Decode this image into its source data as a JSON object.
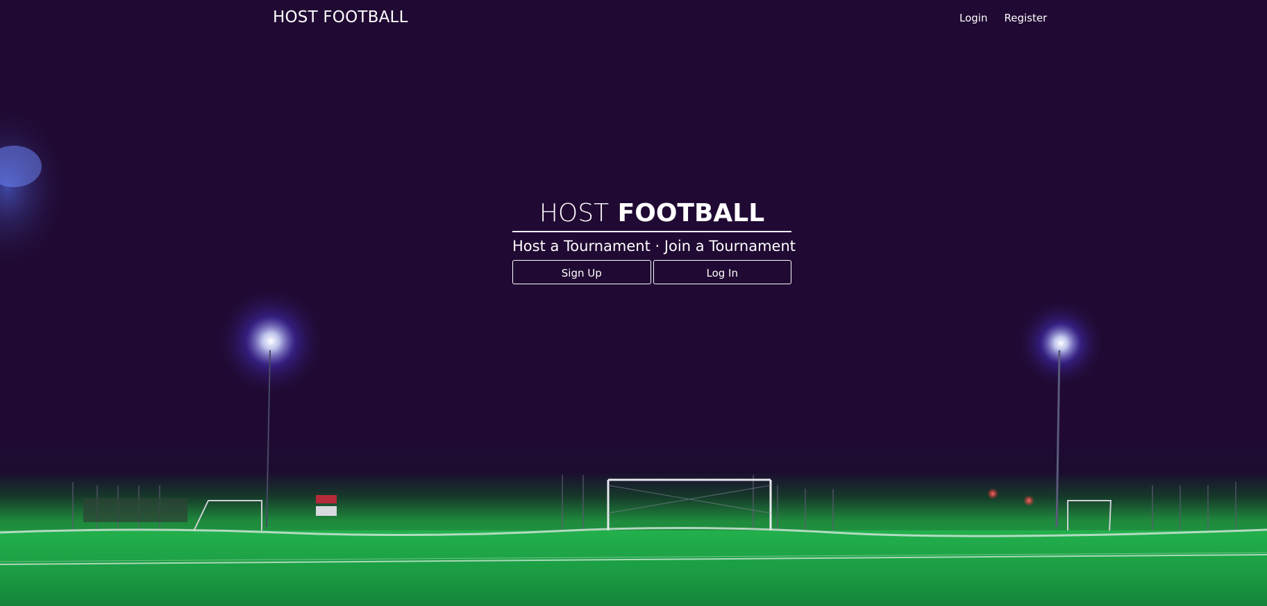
{
  "navbar": {
    "brand": "HOST FOOTBALL",
    "links": [
      "Login",
      "Register"
    ]
  },
  "hero": {
    "title_light": "HOST",
    "title_bold": "FOOTBALL",
    "subtitle": "Host a Tournament · Join a Tournament",
    "buttons": [
      "Sign Up",
      "Log In"
    ]
  },
  "background": {
    "description_icon": "stadium-night-background",
    "sky_color": "#200a33",
    "grass_color": "#1fa447"
  }
}
